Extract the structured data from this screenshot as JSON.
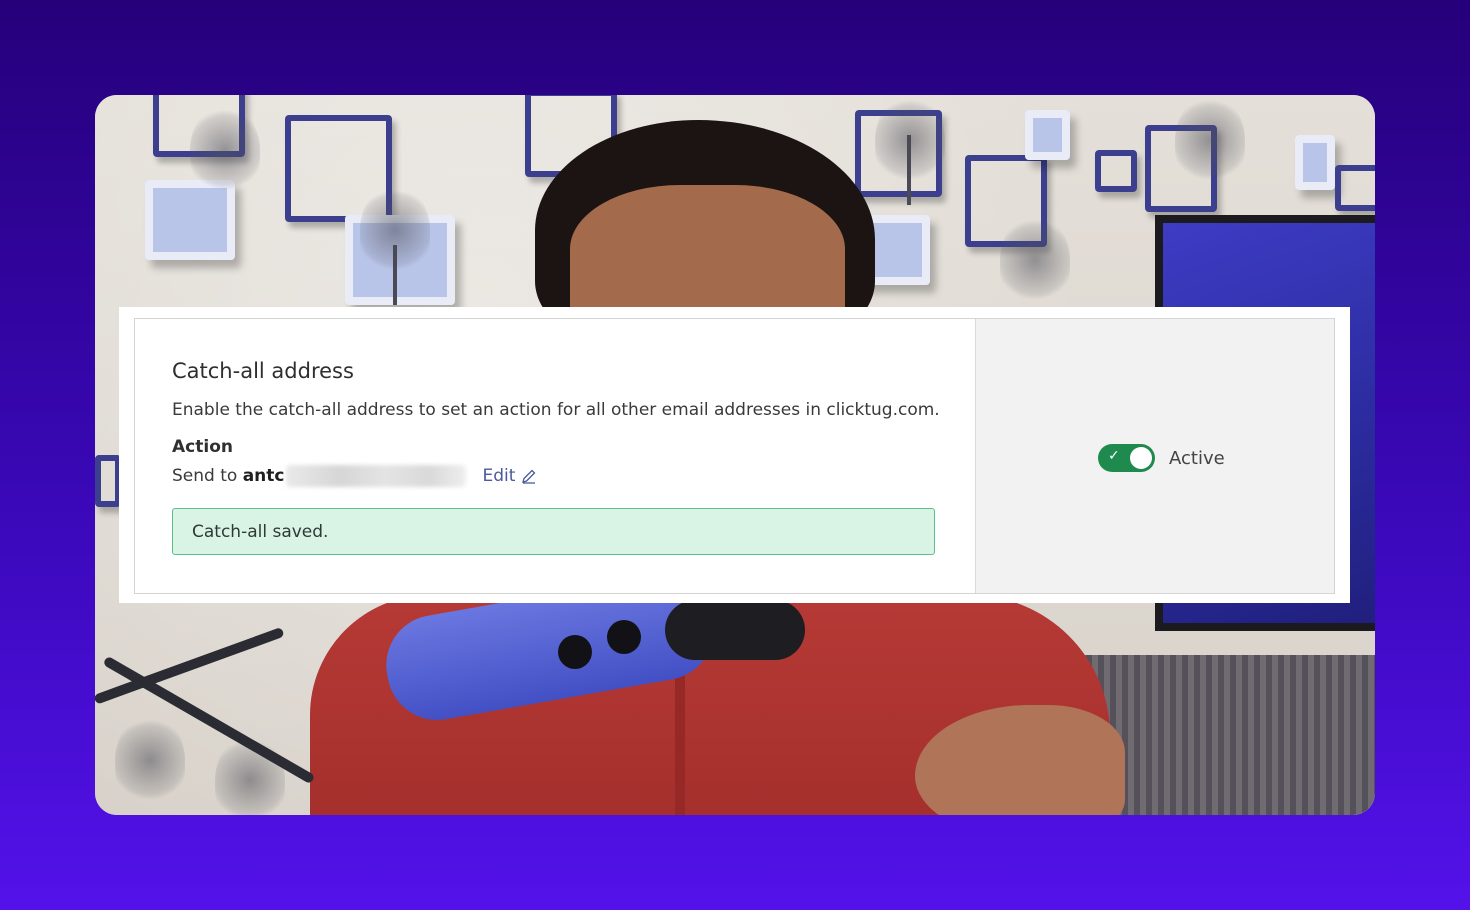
{
  "card": {
    "title": "Catch-all address",
    "description": "Enable the catch-all address to set an action for all other email addresses in clicktug.com.",
    "action_label": "Action",
    "send_prefix": "Send to ",
    "send_target_visible": "antc",
    "edit_label": "Edit",
    "alert_text": "Catch-all saved.",
    "toggle_label": "Active",
    "toggle_state": "on"
  },
  "colors": {
    "background_top": "#25007a",
    "background_bottom": "#5312ea",
    "toggle_on": "#1f8a4e",
    "alert_bg": "#d9f3e5",
    "alert_border": "#5bbf8e",
    "edit_link": "#4a5a9a"
  },
  "icons": [
    "pencil-icon",
    "check-icon"
  ]
}
